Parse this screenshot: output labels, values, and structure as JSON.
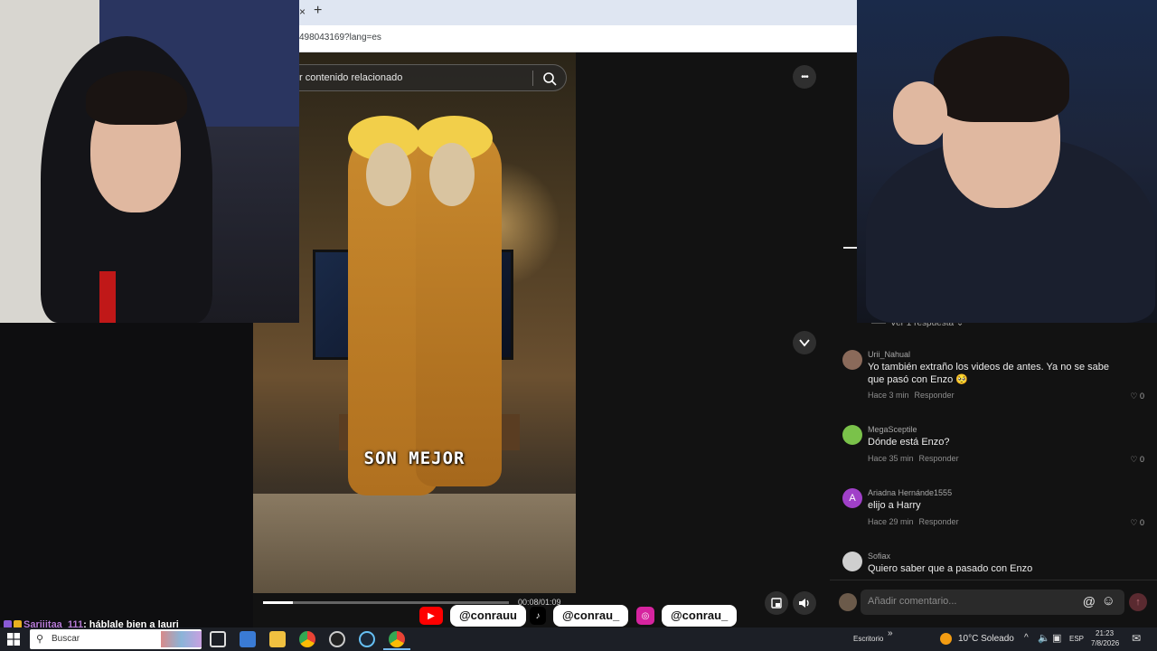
{
  "browser": {
    "url": "498043169?lang=es",
    "new_tab_glyph": "+",
    "tab_close_glyph": "×"
  },
  "search": {
    "placeholder": "r contenido relacionado",
    "icon": "search-icon"
  },
  "video": {
    "caption": "SON MEJOR",
    "timecode": "00:08/01:09",
    "progress_fraction": 0.12
  },
  "controls": {
    "more_glyph": "•••",
    "down_glyph": "⌄",
    "pip_icon": "picture-in-picture-icon",
    "volume_icon": "volume-icon"
  },
  "comments": {
    "reply_toggle": "Ver 1 respuesta ⌄",
    "items": [
      {
        "user": "Urii_Nahual",
        "text": "Yo también extraño los videos de antes. Ya no se sabe que pasó con Enzo 🥺",
        "time": "Hace 3 min",
        "reply": "Responder",
        "likes": "0",
        "avatar_color": "#8a6a5a"
      },
      {
        "user": "MegaSceptile",
        "text": "Dónde está Enzo?",
        "time": "Hace 35 min",
        "reply": "Responder",
        "likes": "0",
        "avatar_color": "#7ac24a"
      },
      {
        "user": "Ariadna Hernánde1555",
        "text": "elijo a Harry",
        "time": "Hace 29 min",
        "reply": "Responder",
        "likes": "0",
        "avatar_color": "#a040c8",
        "avatar_letter": "A"
      },
      {
        "user": "Sofiax",
        "text": "Quiero saber que a pasado con Enzo",
        "avatar_color": "#cfcfcf"
      }
    ],
    "input_placeholder": "Añadir comentario...",
    "mention_glyph": "@",
    "emoji_glyph": "☺",
    "post_glyph": "↑"
  },
  "overlay": {
    "chat_user": "Sarijitaa_111",
    "chat_message": ": háblale bien a lauri",
    "socials": [
      {
        "platform": "youtube",
        "handle": "@conrauu",
        "color": "#ff0000",
        "glyph": "▶"
      },
      {
        "platform": "tiktok",
        "handle": "@conrau_",
        "color": "#000000",
        "glyph": "♪"
      },
      {
        "platform": "instagram",
        "handle": "@conrau_",
        "color": "#d6249f",
        "glyph": "◎"
      }
    ]
  },
  "taskbar": {
    "search_placeholder": "Buscar",
    "desktop_label": "Escritorio",
    "weather": "10°C  Soleado",
    "language": "ESP",
    "time": "21:23",
    "date": "7/8/2026",
    "chevron": "»",
    "tray_up": "^"
  },
  "colors": {
    "accent_red": "#fe2c55",
    "taskbar_bg": "#1c1f26",
    "panel_bg": "#121212"
  }
}
